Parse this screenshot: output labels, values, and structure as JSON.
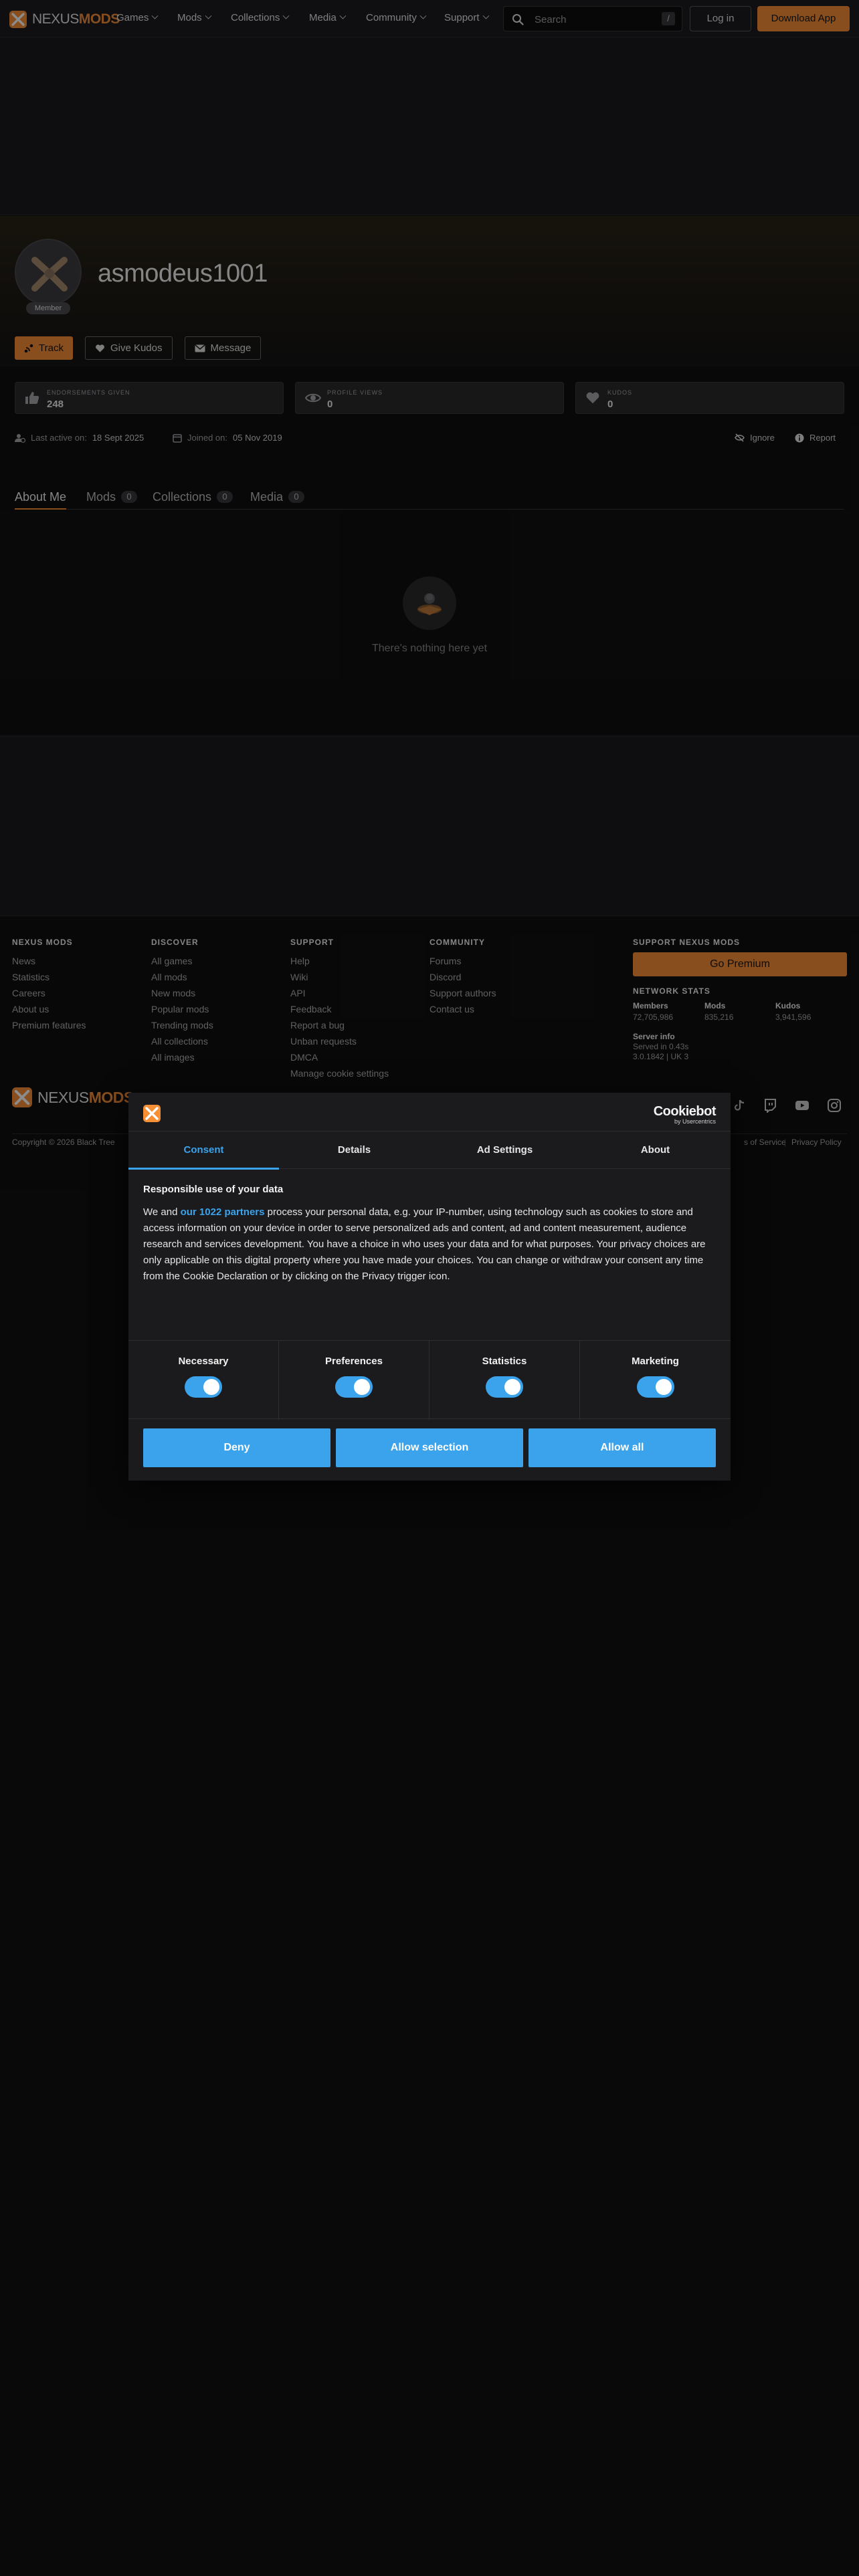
{
  "brand": {
    "name_part1": "NEXUS",
    "name_part2": "MODS",
    "accent": "#f78f35",
    "logo_icon": "nexus-mods-logo-icon"
  },
  "nav": {
    "items": [
      {
        "label": "Games"
      },
      {
        "label": "Mods"
      },
      {
        "label": "Collections"
      },
      {
        "label": "Media"
      },
      {
        "label": "Community"
      },
      {
        "label": "Support"
      }
    ],
    "search_placeholder": "Search",
    "search_shortcut": "/",
    "login_label": "Log in",
    "download_label": "Download App"
  },
  "profile": {
    "username": "asmodeus1001",
    "badge": "Member",
    "actions": {
      "track": "Track",
      "kudos": "Give Kudos",
      "message": "Message"
    },
    "stats": [
      {
        "label": "ENDORSEMENTS GIVEN",
        "value": "248",
        "icon": "thumbs-up-icon"
      },
      {
        "label": "PROFILE VIEWS",
        "value": "0",
        "icon": "eye-icon"
      },
      {
        "label": "KUDOS",
        "value": "0",
        "icon": "heart-icon"
      }
    ],
    "last_active_label": "Last active on:",
    "last_active_value": "18 Sept 2025",
    "joined_label": "Joined on:",
    "joined_value": "05 Nov 2019",
    "ignore_label": "Ignore",
    "report_label": "Report"
  },
  "tabs": [
    {
      "label": "About Me",
      "count": ""
    },
    {
      "label": "Mods",
      "count": "0"
    },
    {
      "label": "Collections",
      "count": "0"
    },
    {
      "label": "Media",
      "count": "0"
    }
  ],
  "empty_state": "There's nothing here yet",
  "footer": {
    "columns": [
      {
        "title": "NEXUS MODS",
        "links": [
          "News",
          "Statistics",
          "Careers",
          "About us",
          "Premium features"
        ]
      },
      {
        "title": "DISCOVER",
        "links": [
          "All games",
          "All mods",
          "New mods",
          "Popular mods",
          "Trending mods",
          "All collections",
          "All images"
        ]
      },
      {
        "title": "SUPPORT",
        "links": [
          "Help",
          "Wiki",
          "API",
          "Feedback",
          "Report a bug",
          "Unban requests",
          "DMCA",
          "Manage cookie settings"
        ]
      },
      {
        "title": "COMMUNITY",
        "links": [
          "Forums",
          "Discord",
          "Support authors",
          "Contact us"
        ]
      }
    ],
    "support_title": "SUPPORT NEXUS MODS",
    "premium_label": "Go Premium",
    "network_title": "NETWORK STATS",
    "network": [
      {
        "k": "Members",
        "v": "72,705,986"
      },
      {
        "k": "Mods",
        "v": "835,216"
      },
      {
        "k": "Kudos",
        "v": "3,941,596"
      }
    ],
    "server_title": "Server info",
    "server_line1": "Served in 0.43s",
    "server_line2": "3.0.1842 | UK 3",
    "copyright": "Copyright © 2026 Black Tree",
    "terms": "s of Service",
    "privacy": "Privacy Policy"
  },
  "cookie": {
    "brand_line1": "Cookiebot",
    "brand_line2": "by Usercentrics",
    "tabs": [
      "Consent",
      "Details",
      "Ad Settings",
      "About"
    ],
    "heading": "Responsible use of your data",
    "body_pre": "We and ",
    "body_link": "our 1022 partners",
    "body_post": " process your personal data, e.g. your IP-number, using technology such as cookies to store and access information on your device in order to serve personalized ads and content, ad and content measurement, audience research and services development. You have a choice in who uses your data and for what purposes. Your privacy choices are only applicable on this digital property where you have made your choices. You can change or withdraw your consent any time from the Cookie Declaration or by clicking on the Privacy trigger icon.",
    "toggles": [
      "Necessary",
      "Preferences",
      "Statistics",
      "Marketing"
    ],
    "deny": "Deny",
    "allow_selection": "Allow selection",
    "allow_all": "Allow all",
    "accent": "#3aa3ec"
  }
}
